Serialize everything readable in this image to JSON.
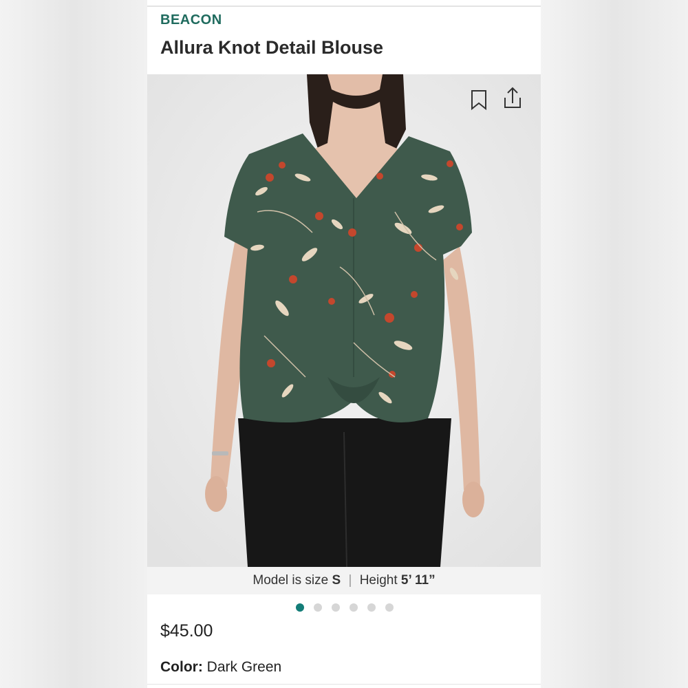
{
  "product": {
    "brand": "BEACON",
    "title": "Allura Knot Detail Blouse",
    "price": "$45.00",
    "color_label": "Color:",
    "color_value": "Dark Green"
  },
  "model_info": {
    "size_label": "Model is size",
    "size_value": "S",
    "separator": "|",
    "height_label": "Height",
    "height_value": "5’ 11”"
  },
  "gallery": {
    "image_count": 6,
    "active_index": 0
  },
  "icons": {
    "bookmark": "bookmark-icon",
    "share": "share-icon"
  },
  "colors": {
    "brand": "#1f6b5e",
    "active_dot": "#137d78",
    "inactive_dot": "#d6d6d6",
    "blouse": "#3f5a4c",
    "pants": "#1a1a1a"
  }
}
